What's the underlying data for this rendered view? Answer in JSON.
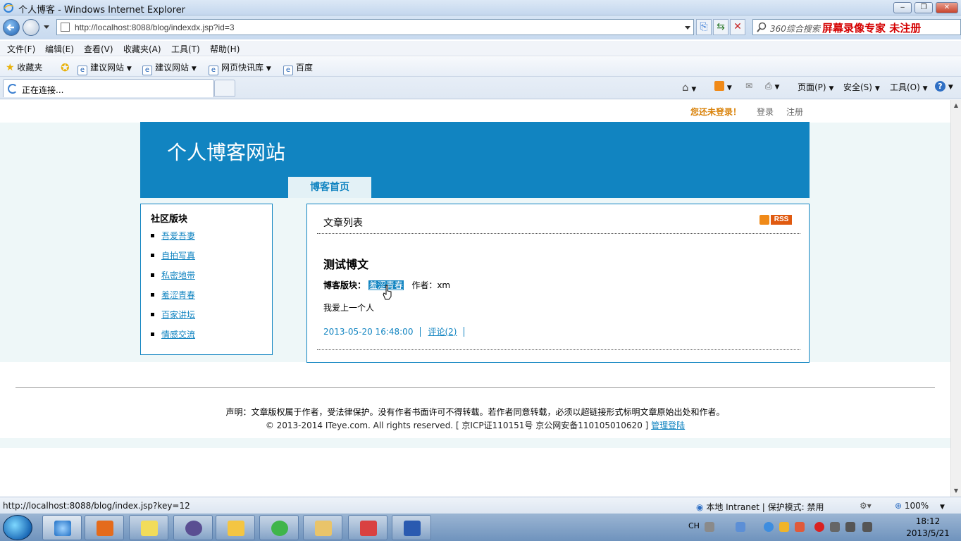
{
  "window": {
    "title": "个人博客 - Windows Internet Explorer",
    "minimize": "‒",
    "restore": "❐",
    "close": "✕"
  },
  "address": {
    "url": "http://localhost:8088/blog/indexdx.jsp?id=3",
    "search_placeholder": "360综合搜索",
    "recorder_watermark": "屏幕录像专家  未注册"
  },
  "menu": [
    "文件(F)",
    "编辑(E)",
    "查看(V)",
    "收藏夹(A)",
    "工具(T)",
    "帮助(H)"
  ],
  "favorites": {
    "label": "收藏夹",
    "items": [
      "建议网站",
      "建议网站",
      "网页快讯库",
      "百度"
    ]
  },
  "tab": {
    "title": "正在连接..."
  },
  "toolbar": {
    "page": "页面(P)",
    "safety": "安全(S)",
    "tools": "工具(O)"
  },
  "page": {
    "login_msg": "您还未登录！",
    "login": "登录",
    "register": "注册",
    "site_title": "个人博客网站",
    "home_tab": "博客首页",
    "sidebar": {
      "heading": "社区版块",
      "items": [
        "吾爱吾妻",
        "自拍写真",
        "私密地带",
        "羞涩青春",
        "百家讲坛",
        "情感交流"
      ]
    },
    "main": {
      "list_title": "文章列表",
      "rss": "RSS",
      "post": {
        "title": "测试博文",
        "section_label": "博客版块：",
        "section": "羞涩青春",
        "author_label": "作者：",
        "author": "xm",
        "body": "我爱上一个人",
        "datetime": "2013-05-20 16:48:00",
        "comments": "评论(2)"
      }
    },
    "footer": {
      "line1": "声明：文章版权属于作者，受法律保护。没有作者书面许可不得转载。若作者同意转载，必须以超链接形式标明文章原始出处和作者。",
      "line2": "© 2013-2014 ITeye.com. All rights reserved. [ 京ICP证110151号  京公网安备110105010620 ]",
      "admin_link": "管理登陆"
    }
  },
  "status": {
    "url": "http://localhost:8088/blog/index.jsp?key=12",
    "zone": "本地 Intranet | 保护模式: 禁用",
    "zoom": "100%"
  },
  "taskbar": {
    "lang": "CH",
    "time": "18:12",
    "date": "2013/5/21"
  }
}
